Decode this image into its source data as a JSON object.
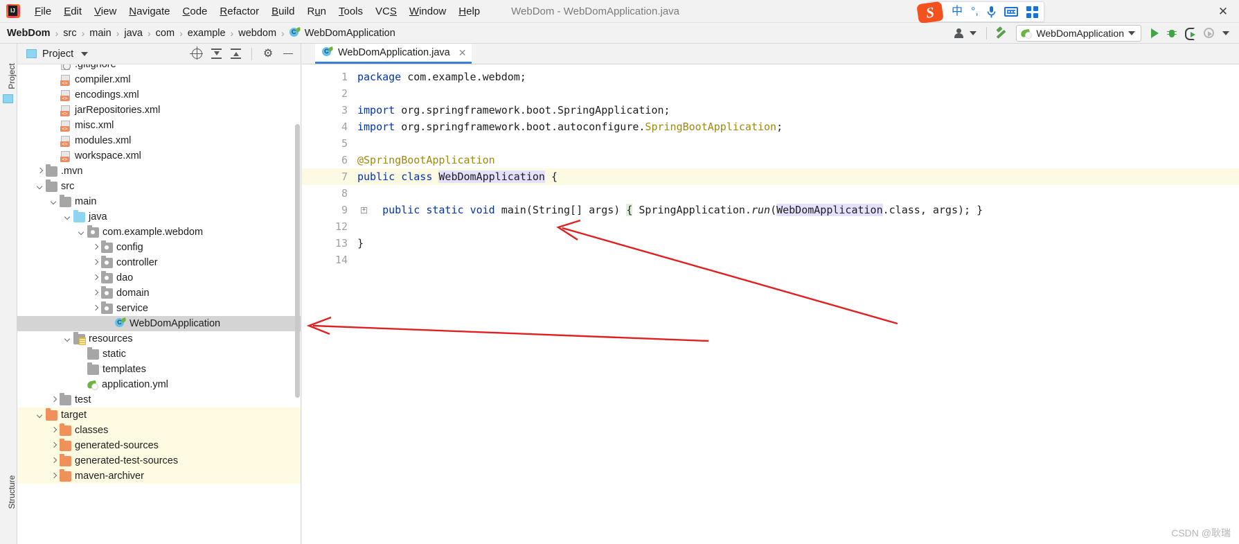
{
  "window": {
    "title": "WebDom - WebDomApplication.java",
    "close_label": "✕"
  },
  "menubar": {
    "items": [
      {
        "label": "File",
        "mnemonic": "F"
      },
      {
        "label": "Edit",
        "mnemonic": "E"
      },
      {
        "label": "View",
        "mnemonic": "V"
      },
      {
        "label": "Navigate",
        "mnemonic": "N"
      },
      {
        "label": "Code",
        "mnemonic": "C"
      },
      {
        "label": "Refactor",
        "mnemonic": "R"
      },
      {
        "label": "Build",
        "mnemonic": "B"
      },
      {
        "label": "Run",
        "mnemonic": "u"
      },
      {
        "label": "Tools",
        "mnemonic": "T"
      },
      {
        "label": "VCS",
        "mnemonic": "S"
      },
      {
        "label": "Window",
        "mnemonic": "W"
      },
      {
        "label": "Help",
        "mnemonic": "H"
      }
    ],
    "logo_icon": "intellij-idea-logo-icon"
  },
  "ime_toolbar": {
    "logo_text": "S",
    "mode_label": "中",
    "punctuation_label": "°,",
    "mic_icon": "microphone-icon",
    "keyboard_icon": "keyboard-icon",
    "apps_icon": "apps-grid-icon"
  },
  "breadcrumb": {
    "separator": "›",
    "items": [
      "WebDom",
      "src",
      "main",
      "java",
      "com",
      "example",
      "webdom",
      "WebDomApplication"
    ]
  },
  "navbar_right": {
    "profile_icon": "user-profile-icon",
    "build_icon": "build-hammer-icon",
    "run_config": {
      "icon": "spring-boot-icon",
      "label": "WebDomApplication"
    },
    "run_icon": "run-play-icon",
    "debug_icon": "debug-bug-icon",
    "coverage_icon": "run-with-coverage-icon",
    "profile_run_icon": "profiler-icon"
  },
  "tool_strip": {
    "project_label": "Project",
    "structure_label": "Structure"
  },
  "project_panel": {
    "title": "Project",
    "locate_icon": "locate-target-icon",
    "expand_icon": "expand-all-icon",
    "collapse_icon": "collapse-all-icon",
    "settings_icon": "gear-icon",
    "hide_icon": "hide-panel-icon",
    "tree": [
      {
        "label": ".gitignore",
        "indent": 2,
        "arrow": "none",
        "icon": "gitignore",
        "partial": true
      },
      {
        "label": "compiler.xml",
        "indent": 2,
        "arrow": "none",
        "icon": "xml"
      },
      {
        "label": "encodings.xml",
        "indent": 2,
        "arrow": "none",
        "icon": "xml"
      },
      {
        "label": "jarRepositories.xml",
        "indent": 2,
        "arrow": "none",
        "icon": "xml"
      },
      {
        "label": "misc.xml",
        "indent": 2,
        "arrow": "none",
        "icon": "xml"
      },
      {
        "label": "modules.xml",
        "indent": 2,
        "arrow": "none",
        "icon": "xml"
      },
      {
        "label": "workspace.xml",
        "indent": 2,
        "arrow": "none",
        "icon": "xml"
      },
      {
        "label": ".mvn",
        "indent": 1,
        "arrow": "right",
        "icon": "folder"
      },
      {
        "label": "src",
        "indent": 1,
        "arrow": "down",
        "icon": "folder"
      },
      {
        "label": "main",
        "indent": 2,
        "arrow": "down",
        "icon": "folder"
      },
      {
        "label": "java",
        "indent": 3,
        "arrow": "down",
        "icon": "folder-blue"
      },
      {
        "label": "com.example.webdom",
        "indent": 4,
        "arrow": "down",
        "icon": "folder-pkg"
      },
      {
        "label": "config",
        "indent": 5,
        "arrow": "right",
        "icon": "folder-pkg"
      },
      {
        "label": "controller",
        "indent": 5,
        "arrow": "right",
        "icon": "folder-pkg"
      },
      {
        "label": "dao",
        "indent": 5,
        "arrow": "right",
        "icon": "folder-pkg"
      },
      {
        "label": "domain",
        "indent": 5,
        "arrow": "right",
        "icon": "folder-pkg"
      },
      {
        "label": "service",
        "indent": 5,
        "arrow": "right",
        "icon": "folder-pkg"
      },
      {
        "label": "WebDomApplication",
        "indent": 6,
        "arrow": "none",
        "icon": "spring-class",
        "selected": true
      },
      {
        "label": "resources",
        "indent": 3,
        "arrow": "down",
        "icon": "folder-res"
      },
      {
        "label": "static",
        "indent": 4,
        "arrow": "none",
        "icon": "folder"
      },
      {
        "label": "templates",
        "indent": 4,
        "arrow": "none",
        "icon": "folder"
      },
      {
        "label": "application.yml",
        "indent": 4,
        "arrow": "none",
        "icon": "spring"
      },
      {
        "label": "test",
        "indent": 2,
        "arrow": "right",
        "icon": "folder"
      },
      {
        "label": "target",
        "indent": 1,
        "arrow": "down",
        "icon": "folder-orange",
        "highlight": true
      },
      {
        "label": "classes",
        "indent": 2,
        "arrow": "right",
        "icon": "folder-orange",
        "highlight": true
      },
      {
        "label": "generated-sources",
        "indent": 2,
        "arrow": "right",
        "icon": "folder-orange",
        "highlight": true
      },
      {
        "label": "generated-test-sources",
        "indent": 2,
        "arrow": "right",
        "icon": "folder-orange",
        "highlight": true
      },
      {
        "label": "maven-archiver",
        "indent": 2,
        "arrow": "right",
        "icon": "folder-orange",
        "highlight": true
      }
    ]
  },
  "editor": {
    "tab": {
      "label": "WebDomApplication.java",
      "icon": "spring-class-icon",
      "close_label": "✕"
    },
    "line_numbers": [
      "1",
      "2",
      "3",
      "4",
      "5",
      "6",
      "7",
      "8",
      "9",
      "12",
      "13",
      "14"
    ],
    "lines": [
      {
        "num": "1",
        "type": "package"
      },
      {
        "num": "2",
        "type": "blank"
      },
      {
        "num": "3",
        "type": "import1"
      },
      {
        "num": "4",
        "type": "import2"
      },
      {
        "num": "5",
        "type": "blank"
      },
      {
        "num": "6",
        "type": "annotation"
      },
      {
        "num": "7",
        "type": "class",
        "highlight": true,
        "run_gutter": true
      },
      {
        "num": "8",
        "type": "blank"
      },
      {
        "num": "9",
        "type": "main",
        "fold": true
      },
      {
        "num": "12",
        "type": "blank"
      },
      {
        "num": "13",
        "type": "closebrace"
      },
      {
        "num": "14",
        "type": "blank"
      }
    ],
    "code": {
      "line1_kw": "package",
      "line1_rest": " com.example.webdom;",
      "line3_kw": "import",
      "line3_rest": " org.springframework.boot.SpringApplication;",
      "line4_kw": "import",
      "line4_mid": " org.springframework.boot.autoconfigure.",
      "line4_cls": "SpringBootApplication",
      "line4_end": ";",
      "line6_annotation": "@SpringBootApplication",
      "line7_kw1": "public",
      "line7_kw2": "class",
      "line7_name": "WebDomApplication",
      "line7_brace": "{",
      "line9_kw1": "public",
      "line9_kw2": "static",
      "line9_kw3": "void",
      "line9_main": "main",
      "line9_args": "(String[] args) ",
      "line9_brace": "{",
      "line9_call": " SpringApplication.",
      "line9_run": "run",
      "line9_open": "(",
      "line9_arg": "WebDomApplication",
      "line9_class": ".class",
      "line9_tail": ", args); ",
      "line9_closebrace": "}",
      "line13_brace": "}"
    }
  },
  "watermark": "CSDN @耿瑞",
  "colors": {
    "accent_blue": "#3c7fd6",
    "keyword": "#0033b3",
    "annotation": "#9e880d",
    "spring_green": "#6db33f",
    "run_green": "#44a248",
    "selection_gray": "#d4d4d4",
    "target_yellow": "#fffbe2",
    "arrow_red": "#e02020"
  }
}
